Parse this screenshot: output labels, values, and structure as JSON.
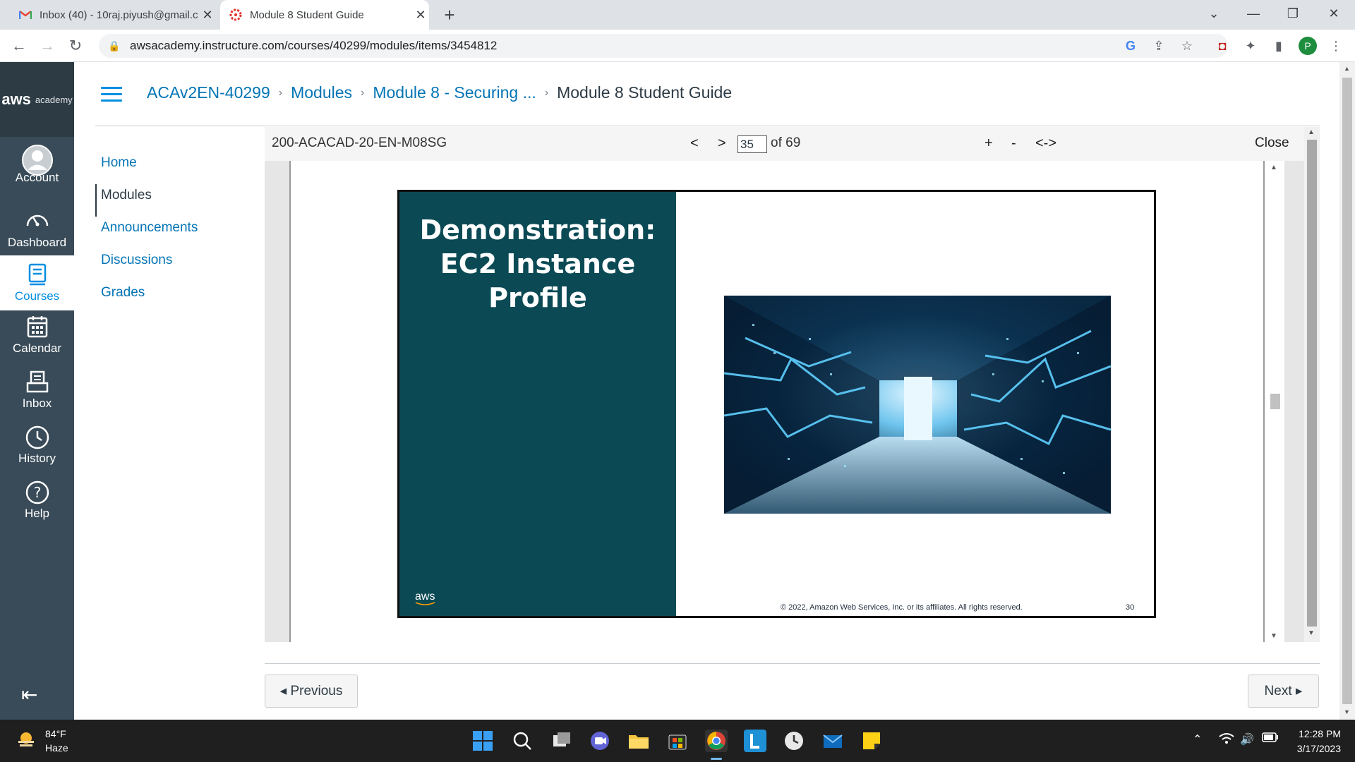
{
  "browser": {
    "tabs": [
      {
        "title": "Inbox (40) - 10raj.piyush@gmail.c",
        "icon": "gmail-icon"
      },
      {
        "title": "Module 8 Student Guide",
        "icon": "canvas-icon"
      }
    ],
    "url": "awsacademy.instructure.com/courses/40299/modules/items/3454812",
    "profile_initial": "P"
  },
  "global_nav": {
    "logo_main": "aws",
    "logo_sub": "academy",
    "items": [
      {
        "label": "Account",
        "icon": "account-icon"
      },
      {
        "label": "Dashboard",
        "icon": "dashboard-icon"
      },
      {
        "label": "Courses",
        "icon": "courses-icon"
      },
      {
        "label": "Calendar",
        "icon": "calendar-icon"
      },
      {
        "label": "Inbox",
        "icon": "inbox-icon"
      },
      {
        "label": "History",
        "icon": "history-icon"
      },
      {
        "label": "Help",
        "icon": "help-icon"
      }
    ]
  },
  "breadcrumb": {
    "course": "ACAv2EN-40299",
    "modules": "Modules",
    "module": "Module 8 - Securing ...",
    "current": "Module 8 Student Guide"
  },
  "course_nav": [
    {
      "label": "Home"
    },
    {
      "label": "Modules"
    },
    {
      "label": "Announcements"
    },
    {
      "label": "Discussions"
    },
    {
      "label": "Grades"
    }
  ],
  "viewer": {
    "doc_id": "200-ACACAD-20-EN-M08SG",
    "prev": "<",
    "next": ">",
    "page": "35",
    "of_total": "of 69",
    "zoom_in": "+",
    "zoom_out": "-",
    "fit": "<->",
    "close": "Close"
  },
  "slide": {
    "title_line1": "Demonstration:",
    "title_line2": "EC2 Instance",
    "title_line3": "Profile",
    "brand": "aws",
    "copyright": "© 2022, Amazon Web Services, Inc. or its affiliates. All rights reserved.",
    "number": "30",
    "colors": {
      "panel": "#0b4a55",
      "glow": "#4fc3f7"
    }
  },
  "pager": {
    "previous": "◂ Previous",
    "next": "Next ▸"
  },
  "taskbar": {
    "temp": "84°F",
    "condition": "Haze",
    "time": "12:28 PM",
    "date": "3/17/2023"
  }
}
